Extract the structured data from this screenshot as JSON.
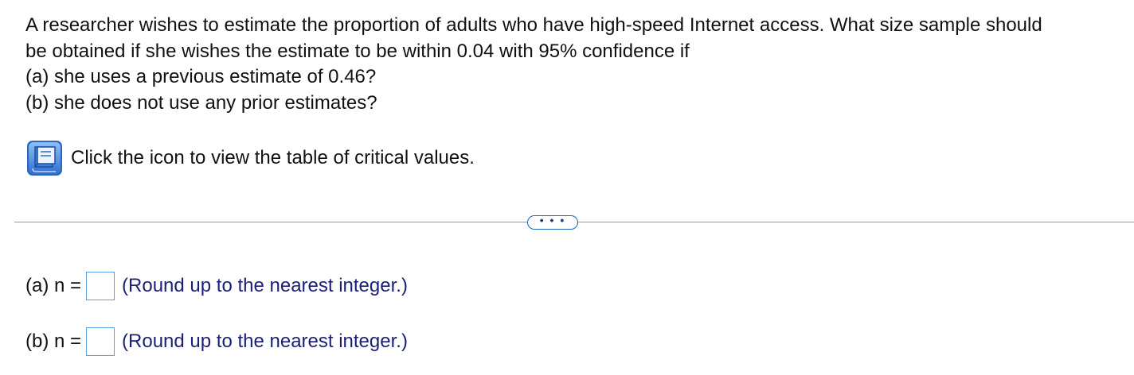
{
  "question": {
    "lines": [
      "A researcher wishes to estimate the proportion of adults who have high-speed Internet access. What size sample should",
      "be obtained if she wishes the estimate to be within 0.04 with 95% confidence if",
      "(a) she uses a previous estimate of 0.46?",
      "(b) she does not use any prior estimates?"
    ]
  },
  "help": {
    "icon": "book-icon",
    "text": "Click the icon to view the table of critical values."
  },
  "more_button": {
    "label": "• • •"
  },
  "answers": [
    {
      "label": "(a) n =",
      "value": "",
      "hint": "(Round up to the nearest integer.)"
    },
    {
      "label": "(b) n =",
      "value": "",
      "hint": "(Round up to the nearest integer.)"
    }
  ],
  "colors": {
    "text": "#111111",
    "hint": "#1b1f7a",
    "input_border": "#5aa0e0",
    "accent": "#1a62b8",
    "divider": "#9a9a9a"
  }
}
